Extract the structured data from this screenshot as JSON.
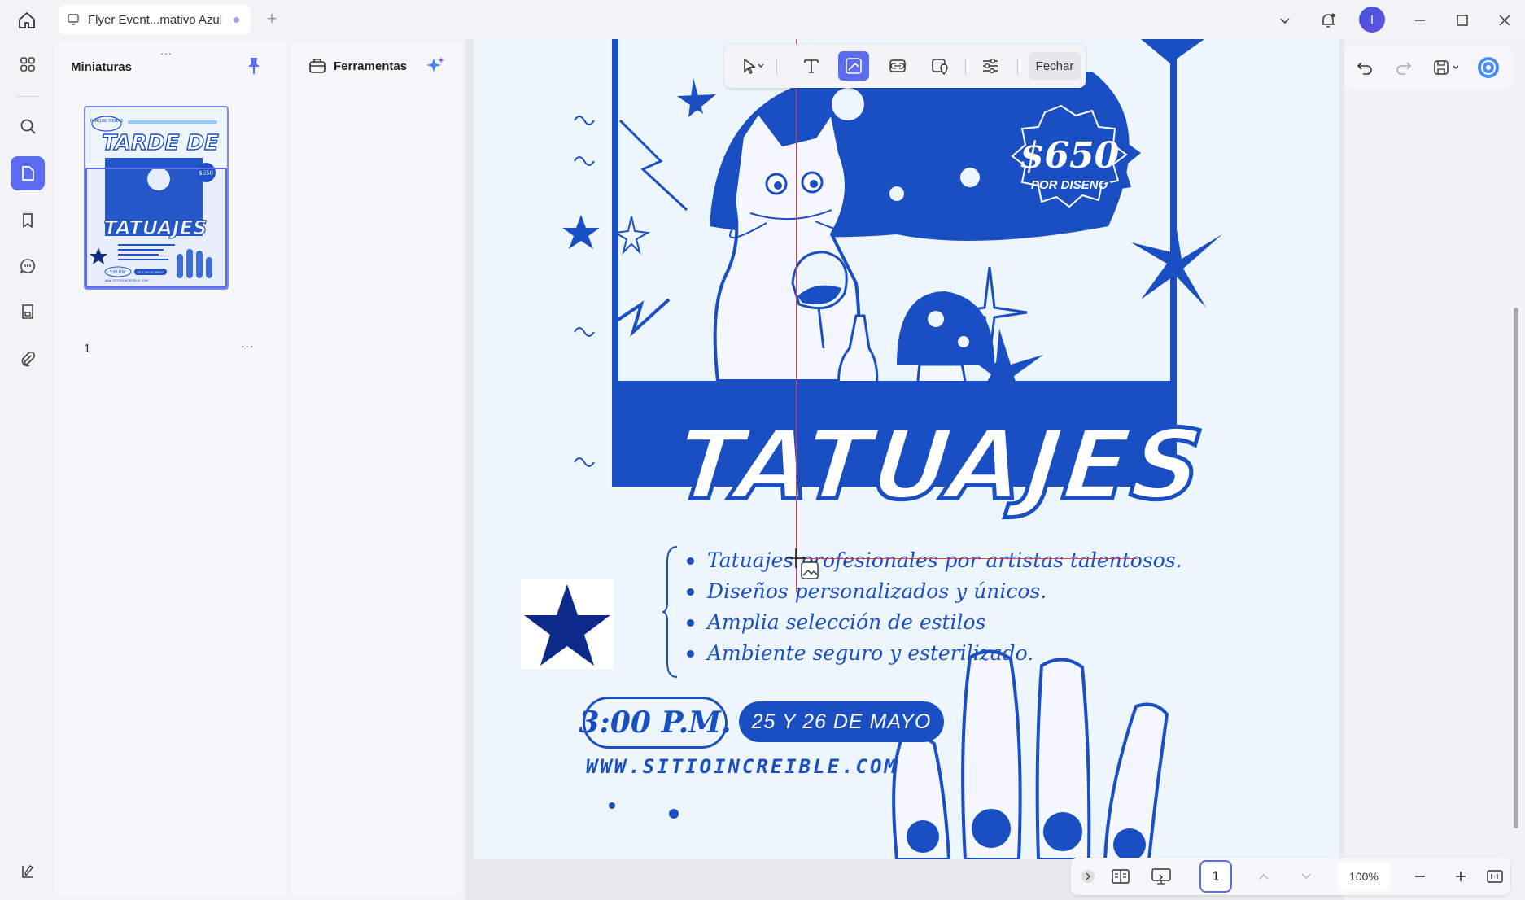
{
  "titlebar": {
    "tab_title": "Flyer Event...mativo Azul",
    "icons": [
      "home-icon",
      "document-icon",
      "plus-icon",
      "chevron-down-icon",
      "bell-icon",
      "avatar",
      "minimize-icon",
      "maximize-icon",
      "close-icon"
    ],
    "avatar_initial": "I"
  },
  "rail": {
    "items": [
      "grid-icon",
      "search-icon",
      "page-icon",
      "bookmark-icon",
      "comment-icon",
      "stamp-icon",
      "attachment-icon",
      "sidebar-toggle-icon"
    ],
    "active": "page-icon"
  },
  "thumbnails": {
    "title": "Miniaturas",
    "page_number": "1",
    "more": "...",
    "grip": "..."
  },
  "tools": {
    "label": "Ferramentas"
  },
  "float_toolbar": {
    "close_label": "Fechar",
    "tools": [
      "select-arrow-icon",
      "text-icon",
      "image-edit-icon",
      "link-icon",
      "location-icon",
      "sliders-icon"
    ],
    "active": "image-edit-icon"
  },
  "poster": {
    "price": "$650",
    "price_sub": "POR DISENO",
    "headline": "TATUAJES",
    "bullets": [
      "Tatuajes profesionales por artistas talentosos.",
      "Diseños personalizados y únicos.",
      "Amplia selección de estilos",
      "Ambiente seguro y esterilizado."
    ],
    "time": "3:00 P.M.",
    "date": "25 Y 26 DE MAYO",
    "url": "WWW.SITIOINCREIBLE.COM"
  },
  "thumb_poster": {
    "badge": "PARQUE VIBRAS",
    "title": "TARDE DE",
    "headline": "TATUAJES",
    "price": "$650",
    "time": "3:00 P.M.",
    "date": "25 Y 26 DE MAYO",
    "url": "WWW.SITIOINCREIBLE.COM"
  },
  "bottom_toolbar": {
    "page_number": "1",
    "zoom": "100%"
  },
  "colors": {
    "accent": "#5b6cf0",
    "poster_blue": "#1a4fc4",
    "page_bg": "#eef6fd"
  }
}
